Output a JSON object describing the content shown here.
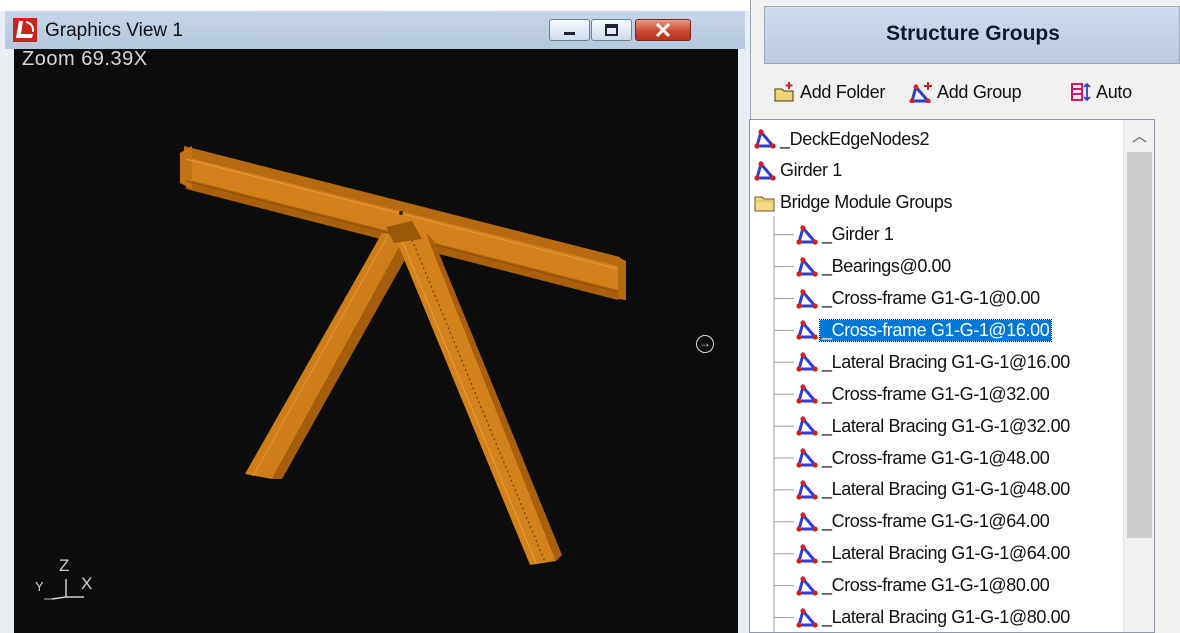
{
  "graphics_view": {
    "title": "Graphics View 1",
    "zoom_label": "Zoom",
    "zoom_value": "69.39X",
    "axes": {
      "up": "Z",
      "right": "X",
      "left": "Y"
    },
    "model_color": "#d07a14",
    "background_color": "#0c0c0c"
  },
  "panel": {
    "title": "Structure Groups",
    "toolbar": {
      "add_folder": "Add Folder",
      "add_group": "Add Group",
      "auto": "Auto"
    },
    "tree": [
      {
        "label": "_DeckEdgeNodes2",
        "icon": "group-icon",
        "level": 0
      },
      {
        "label": "Girder 1",
        "icon": "group-icon",
        "level": 0
      },
      {
        "label": "Bridge Module Groups",
        "icon": "folder-icon",
        "level": 0
      },
      {
        "label": "_Girder 1",
        "icon": "group-icon",
        "level": 1
      },
      {
        "label": "_Bearings@0.00",
        "icon": "group-icon",
        "level": 1
      },
      {
        "label": "_Cross-frame G1-G-1@0.00",
        "icon": "group-icon",
        "level": 1
      },
      {
        "label": "_Cross-frame G1-G-1@16.00",
        "icon": "group-icon",
        "level": 1,
        "selected": true
      },
      {
        "label": "_Lateral Bracing G1-G-1@16.00",
        "icon": "group-icon",
        "level": 1
      },
      {
        "label": "_Cross-frame G1-G-1@32.00",
        "icon": "group-icon",
        "level": 1
      },
      {
        "label": "_Lateral Bracing G1-G-1@32.00",
        "icon": "group-icon",
        "level": 1
      },
      {
        "label": "_Cross-frame G1-G-1@48.00",
        "icon": "group-icon",
        "level": 1
      },
      {
        "label": "_Lateral Bracing G1-G-1@48.00",
        "icon": "group-icon",
        "level": 1
      },
      {
        "label": "_Cross-frame G1-G-1@64.00",
        "icon": "group-icon",
        "level": 1
      },
      {
        "label": "_Lateral Bracing G1-G-1@64.00",
        "icon": "group-icon",
        "level": 1
      },
      {
        "label": "_Cross-frame G1-G-1@80.00",
        "icon": "group-icon",
        "level": 1
      },
      {
        "label": "_Lateral Bracing G1-G-1@80.00",
        "icon": "group-icon",
        "level": 1
      }
    ],
    "selection_color": "#0078d7"
  }
}
